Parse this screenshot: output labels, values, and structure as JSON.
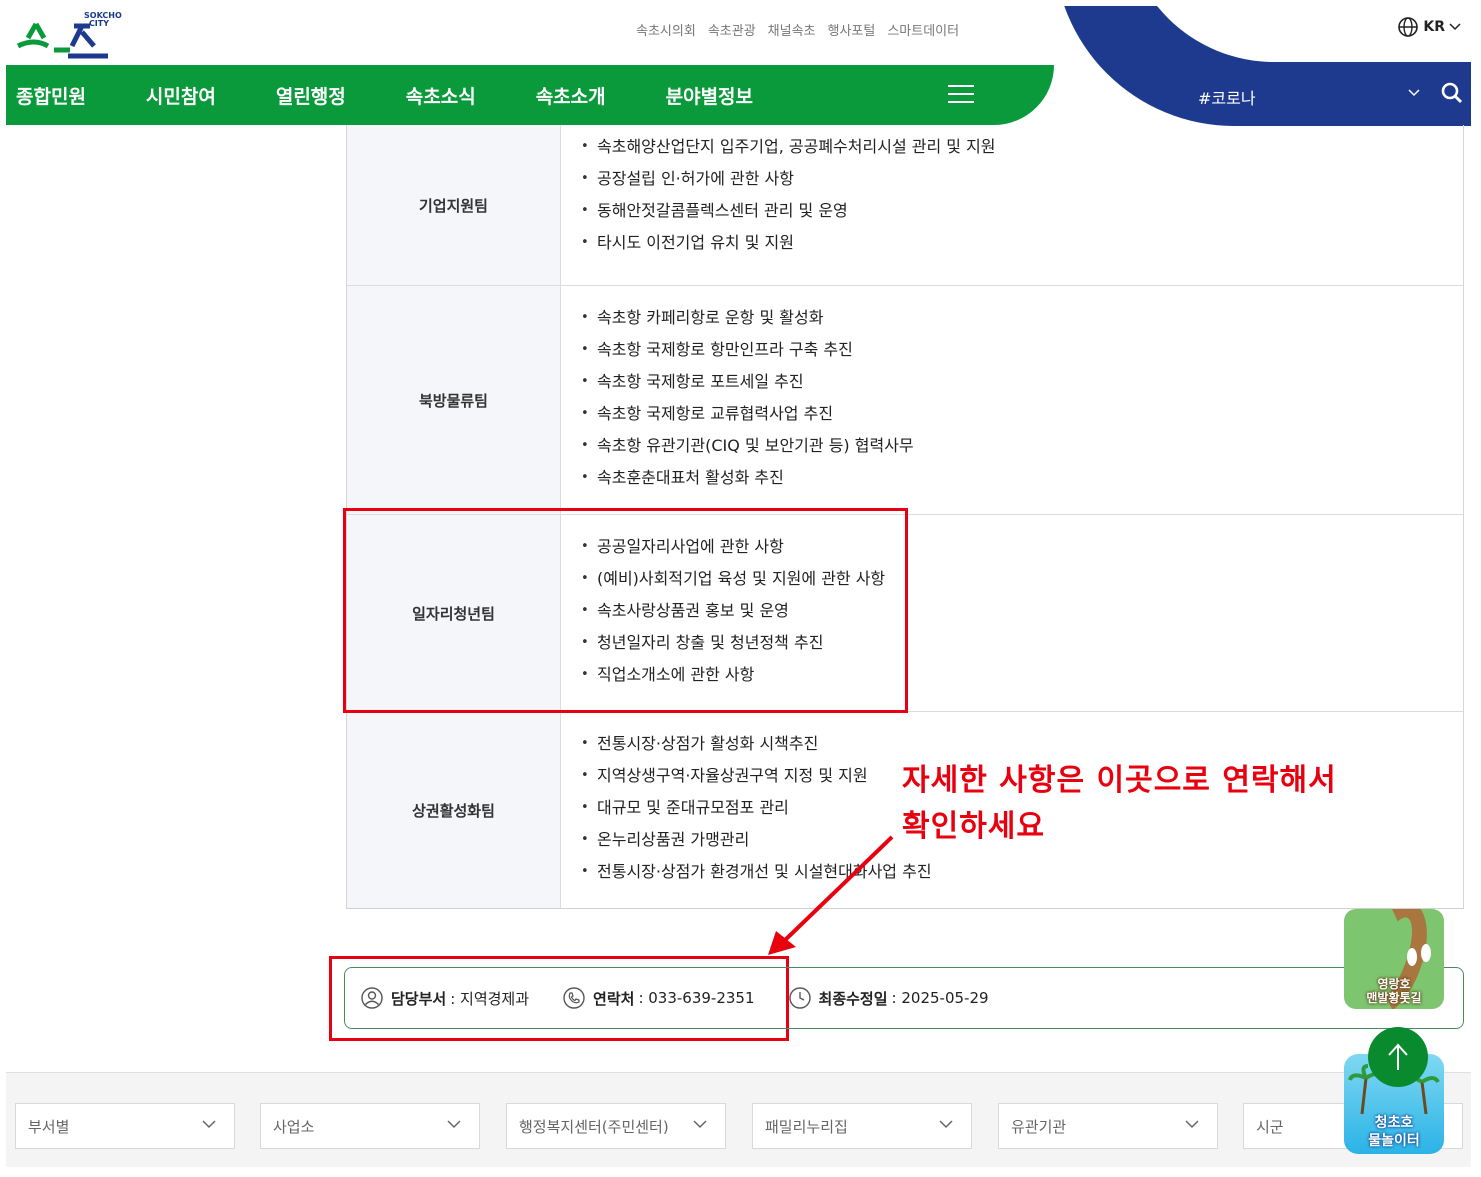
{
  "header": {
    "logo_text": "속초",
    "logo_en": "SOKCHO CITY",
    "top_links": [
      "속초시의회",
      "속초관광",
      "채널속초",
      "행사포털",
      "스마트데이터"
    ],
    "lang": "KR",
    "nav": [
      "종합민원",
      "시민참여",
      "열린행정",
      "속초소식",
      "속초소개",
      "분야별정보"
    ],
    "search_keyword": "#코로나"
  },
  "table": {
    "rows": [
      {
        "team": "기업지원팀",
        "duties": [
          "속초해양산업단지 입주기업, 공공폐수처리시설 관리 및 지원",
          "공장설립 인·허가에 관한 사항",
          "동해안젓갈콤플렉스센터 관리 및 운영",
          "타시도 이전기업 유치 및 지원"
        ]
      },
      {
        "team": "북방물류팀",
        "duties": [
          "속초항 카페리항로 운항 및 활성화",
          "속초항 국제항로 항만인프라 구축 추진",
          "속초항 국제항로 포트세일 추진",
          "속초항 국제항로 교류협력사업 추진",
          "속초항 유관기관(CIQ 및 보안기관 등) 협력사무",
          "속초훈춘대표처 활성화 추진"
        ]
      },
      {
        "team": "일자리청년팀",
        "duties": [
          "공공일자리사업에 관한 사항",
          "(예비)사회적기업 육성 및 지원에 관한 사항",
          "속초사랑상품권 홍보 및 운영",
          "청년일자리 창출 및 청년정책 추진",
          "직업소개소에 관한 사항"
        ]
      },
      {
        "team": "상권활성화팀",
        "duties": [
          "전통시장·상점가 활성화 시책추진",
          "지역상생구역·자율상권구역 지정 및 지원",
          "대규모 및 준대규모점포 관리",
          "온누리상품권 가맹관리",
          "전통시장·상점가 환경개선 및 시설현대화사업 추진"
        ]
      }
    ]
  },
  "annotation": {
    "line1": "자세한 사항은 이곳으로 연락해서",
    "line2": "확인하세요"
  },
  "info": {
    "dept_label": "담당부서",
    "dept_value": ": 지역경제과",
    "contact_label": "연락처",
    "contact_value": ": 033-639-2351",
    "updated_label": "최종수정일",
    "updated_value": ": 2025-05-29"
  },
  "bottom_selects": [
    "부서별",
    "사업소",
    "행정복지센터(주민센터)",
    "패밀리누리집",
    "유관기관",
    "시군"
  ],
  "floating": {
    "banner1": [
      "영랑호",
      "맨발황톳길"
    ],
    "banner2": [
      "청초호",
      "물놀이터"
    ]
  },
  "colors": {
    "green": "#0a9a3c",
    "navy": "#1d3a8f",
    "highlight": "#e60012"
  }
}
